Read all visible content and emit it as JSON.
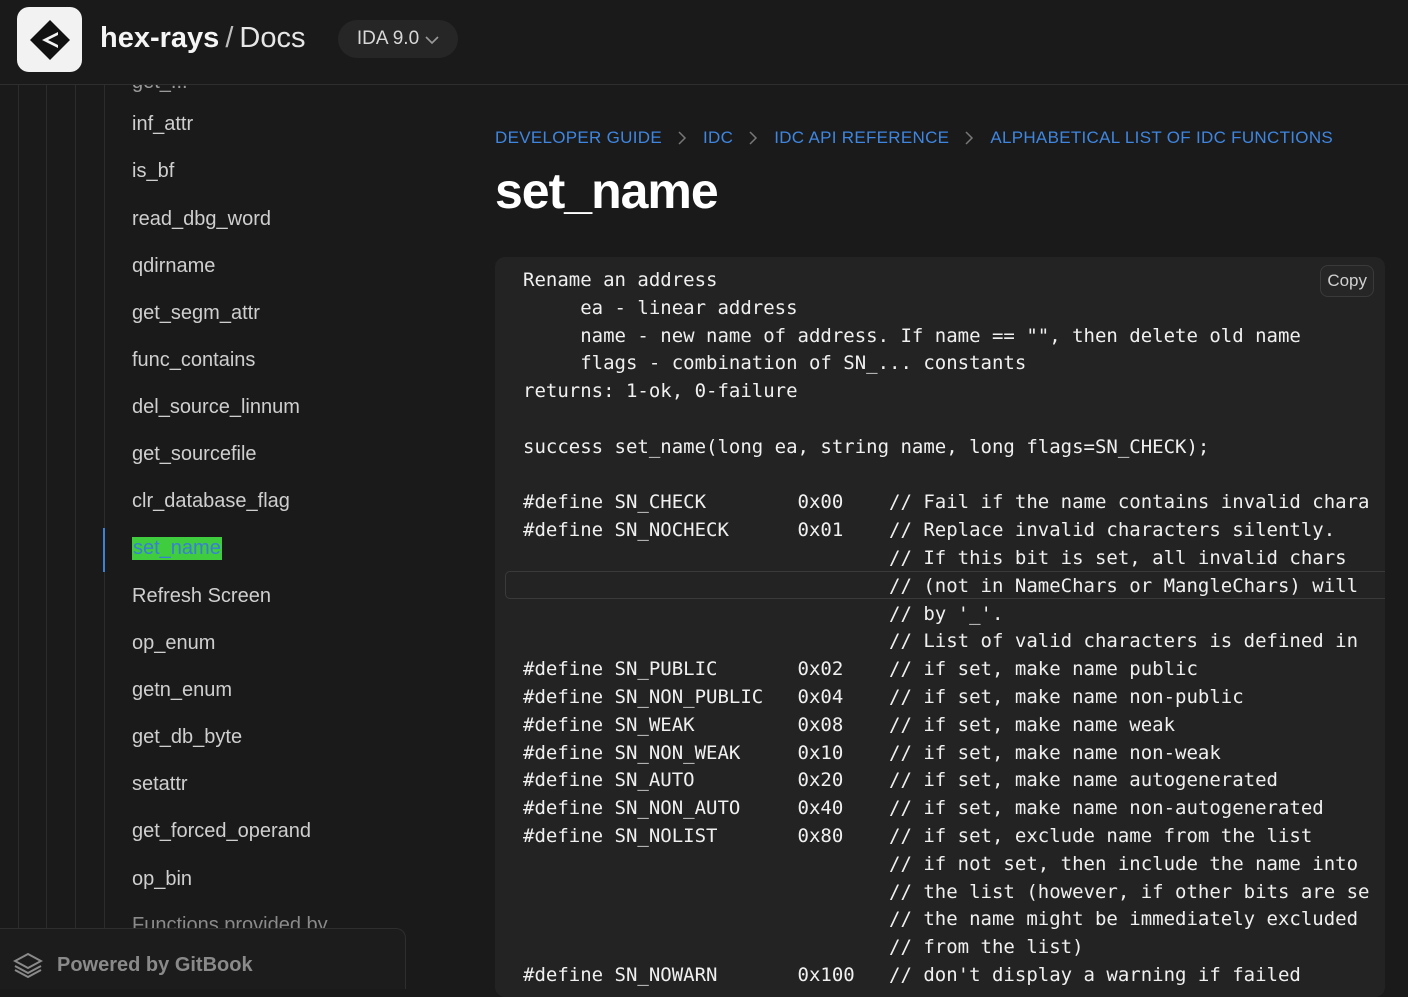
{
  "header": {
    "brand_name": "hex-rays",
    "brand_separator": "/",
    "brand_section": "Docs",
    "version_label": "IDA 9.0",
    "logo_icon": "hexrays-diamond-logo-icon"
  },
  "sidebar": {
    "partial_top": "get_...",
    "items": [
      {
        "label": "inf_attr"
      },
      {
        "label": "is_bf"
      },
      {
        "label": "read_dbg_word"
      },
      {
        "label": "qdirname"
      },
      {
        "label": "get_segm_attr"
      },
      {
        "label": "func_contains"
      },
      {
        "label": "del_source_linnum"
      },
      {
        "label": "get_sourcefile"
      },
      {
        "label": "clr_database_flag"
      },
      {
        "label": "set_name",
        "active": true
      },
      {
        "label": "Refresh Screen"
      },
      {
        "label": "op_enum"
      },
      {
        "label": "getn_enum"
      },
      {
        "label": "get_db_byte"
      },
      {
        "label": "setattr"
      },
      {
        "label": "get_forced_operand"
      },
      {
        "label": "op_bin"
      }
    ],
    "partial_bottom": "Functions provided by",
    "powered_by": "Powered by GitBook"
  },
  "breadcrumb": [
    "DEVELOPER GUIDE",
    "IDC",
    "IDC API REFERENCE",
    "ALPHABETICAL LIST OF IDC FUNCTIONS"
  ],
  "page_title": "set_name",
  "code": {
    "copy_label": "Copy",
    "lines": [
      "Rename an address",
      "     ea - linear address",
      "     name - new name of address. If name == \"\", then delete old name",
      "     flags - combination of SN_... constants",
      "returns: 1-ok, 0-failure",
      "",
      "success set_name(long ea, string name, long flags=SN_CHECK);",
      "",
      "#define SN_CHECK        0x00    // Fail if the name contains invalid chara",
      "#define SN_NOCHECK      0x01    // Replace invalid characters silently.",
      "                                // If this bit is set, all invalid chars",
      "                                // (not in NameChars or MangleChars) will",
      "                                // by '_'.",
      "                                // List of valid characters is defined in",
      "#define SN_PUBLIC       0x02    // if set, make name public",
      "#define SN_NON_PUBLIC   0x04    // if set, make name non-public",
      "#define SN_WEAK         0x08    // if set, make name weak",
      "#define SN_NON_WEAK     0x10    // if set, make name non-weak",
      "#define SN_AUTO         0x20    // if set, make name autogenerated",
      "#define SN_NON_AUTO     0x40    // if set, make name non-autogenerated",
      "#define SN_NOLIST       0x80    // if set, exclude name from the list",
      "                                // if not set, then include the name into",
      "                                // the list (however, if other bits are se",
      "                                // the name might be immediately excluded",
      "                                // from the list)",
      "#define SN_NOWARN       0x100   // don't display a warning if failed"
    ]
  },
  "colors": {
    "background": "#1a1a1a",
    "link": "#3f86e0",
    "active_highlight": "#3fcc3f",
    "code_bg": "#232323"
  }
}
